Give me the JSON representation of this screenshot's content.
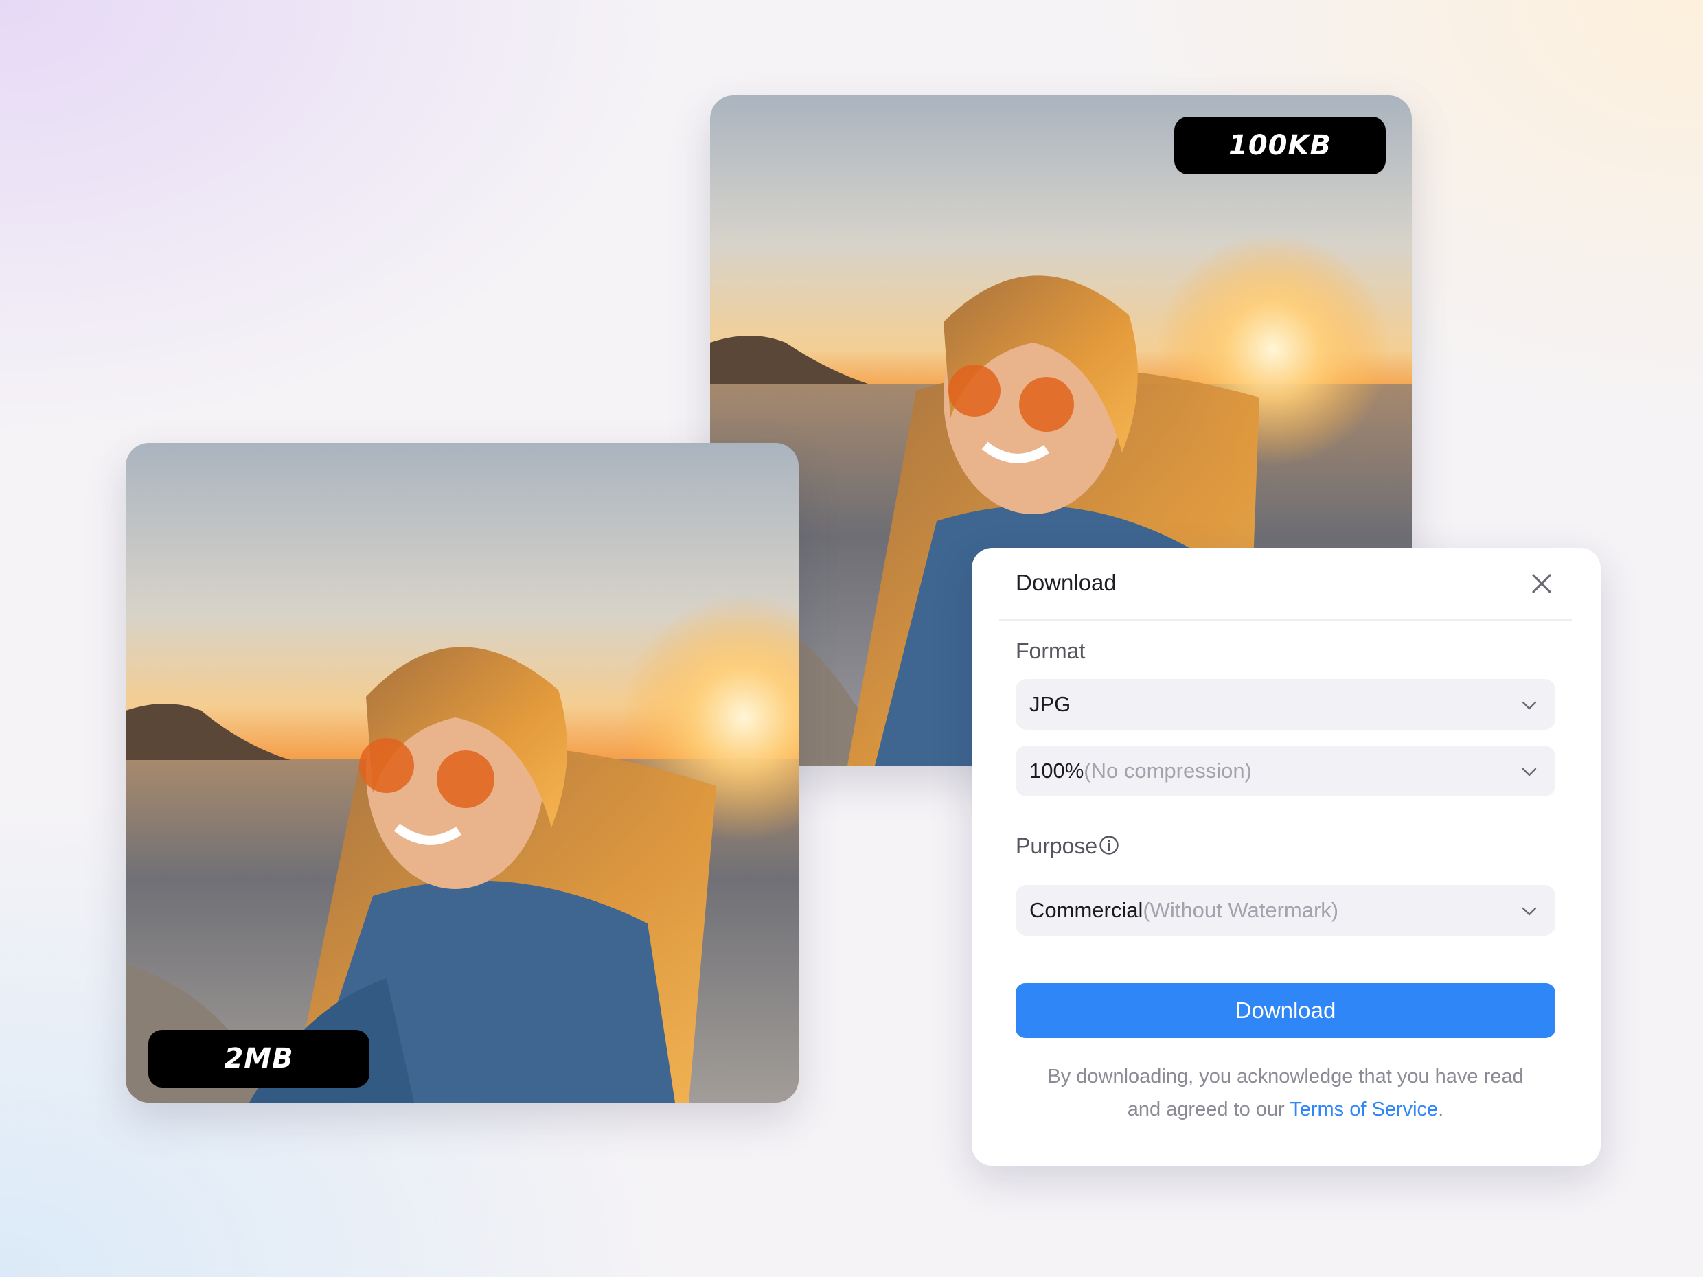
{
  "badges": {
    "compressed_size": "100KB",
    "original_size": "2MB"
  },
  "dialog": {
    "title": "Download",
    "close_icon": "close-icon",
    "format_label": "Format",
    "format_value": "JPG",
    "quality_value": "100%",
    "quality_note": "(No compression)",
    "purpose_label": "Purpose",
    "purpose_value": "Commercial",
    "purpose_note": "(Without Watermark)",
    "download_button": "Download",
    "terms_prefix": "By downloading, you acknowledge that you have read",
    "terms_line2": "and agreed to our ",
    "terms_link": "Terms of Service",
    "terms_suffix": "."
  },
  "colors": {
    "accent": "#2f86f6",
    "badge_bg": "#000000"
  }
}
